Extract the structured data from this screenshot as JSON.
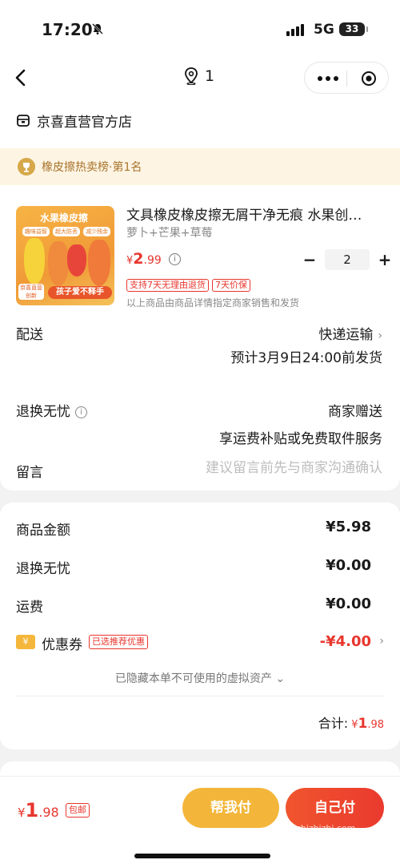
{
  "status_bar": {
    "time": "17:20",
    "network": "5G",
    "battery": "33"
  },
  "nav": {
    "location_count": "1"
  },
  "shop": {
    "name": "京喜直营官方店"
  },
  "rank": {
    "text": "橡皮擦热卖榜·第1名"
  },
  "product": {
    "title": "文具橡皮橡皮擦无屑干净无痕 水果创…",
    "spec": "萝卜+芒果+草莓",
    "price_symbol": "¥",
    "price_int": "2",
    "price_dec": ".99",
    "quantity": "2",
    "tags": [
      "支持7天无理由退货",
      "7天价保"
    ],
    "notice": "以上商品由商品详情指定商家销售和发货",
    "image": {
      "header": "水果橡皮擦",
      "chips": [
        "趣味益智",
        "超大防丢",
        "减少残余"
      ],
      "foot_left": "京喜直营 创新",
      "foot_right": "孩子爱不释手"
    }
  },
  "delivery": {
    "label": "配送",
    "method": "快递运输",
    "estimate": "预计3月9日24:00前发货"
  },
  "returns": {
    "label": "退换无忧",
    "value": "商家赠送",
    "desc": "享运费补贴或免费取件服务"
  },
  "message": {
    "label": "留言",
    "placeholder": "建议留言前先与商家沟通确认"
  },
  "summary": {
    "goods_label": "商品金额",
    "goods_value": "¥5.98",
    "returns_label": "退换无忧",
    "returns_value": "¥0.00",
    "shipping_label": "运费",
    "shipping_value": "¥0.00",
    "coupon_icon": "¥",
    "coupon_label": "优惠券",
    "coupon_tag": "已选推荐优惠",
    "coupon_value": "-¥4.00",
    "hidden_note": "已隐藏本单不可使用的虚拟资产",
    "total_label": "合计:",
    "total_symbol": "¥",
    "total_int": "1",
    "total_dec": ".98"
  },
  "bottom": {
    "price_symbol": "¥",
    "price_int": "1",
    "price_dec": ".98",
    "free_shipping": "包邮",
    "help_pay": "帮我付",
    "submit": "自己付",
    "watermark": "zhizhizhi.com"
  },
  "colors": {
    "accent_red": "#e8362e",
    "gold": "#f3b63a",
    "rank_bg": "#fdf4e3"
  }
}
